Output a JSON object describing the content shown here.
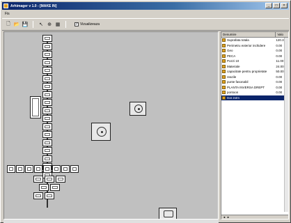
{
  "app": {
    "title": "Arhimager v 1.0 - [MAKE IN]",
    "min_glyph": "_",
    "max_glyph": "□",
    "close_glyph": "×",
    "icon": "app-icon"
  },
  "menu": {
    "items": [
      "Fis"
    ]
  },
  "toolbar": {
    "buttons": [
      {
        "name": "new-icon",
        "glyph": "🗋"
      },
      {
        "name": "open-icon",
        "glyph": "📂"
      },
      {
        "name": "save-icon",
        "glyph": "💾"
      },
      {
        "name": "pointer-icon",
        "glyph": "↖"
      },
      {
        "name": "zoom-icon",
        "glyph": "⊕"
      },
      {
        "name": "grid-icon",
        "glyph": "▦"
      }
    ],
    "checkbox_label": "Vizualizeaza",
    "checkbox_checked": true
  },
  "panel": {
    "col1": "Denumire",
    "col2": "Valo",
    "rows": [
      {
        "name": "Suprafata totala",
        "value": "120.3",
        "selected": false
      },
      {
        "name": "Perimetru exterior inchidere",
        "value": "0.00",
        "selected": false
      },
      {
        "name": "Geo",
        "value": "0.00",
        "selected": false
      },
      {
        "name": "PECA",
        "value": "0.00",
        "selected": false
      },
      {
        "name": "Pozzi 10",
        "value": "11.00",
        "selected": false
      },
      {
        "name": "Materiale",
        "value": "24.00",
        "selected": false
      },
      {
        "name": "capacitate pentru proprietate",
        "value": "50.00",
        "selected": false
      },
      {
        "name": "reazile",
        "value": "0.00",
        "selected": false
      },
      {
        "name": "punte fasonabil",
        "value": "0.00",
        "selected": false
      },
      {
        "name": "PLANTA INVERSA DREPT",
        "value": "0.00",
        "selected": false
      },
      {
        "name": "pontoon",
        "value": "0.00",
        "selected": false
      },
      {
        "name": "Dat 2xtm",
        "value": "",
        "selected": true
      }
    ],
    "scroll_left": "◄",
    "scroll_right": "►"
  }
}
